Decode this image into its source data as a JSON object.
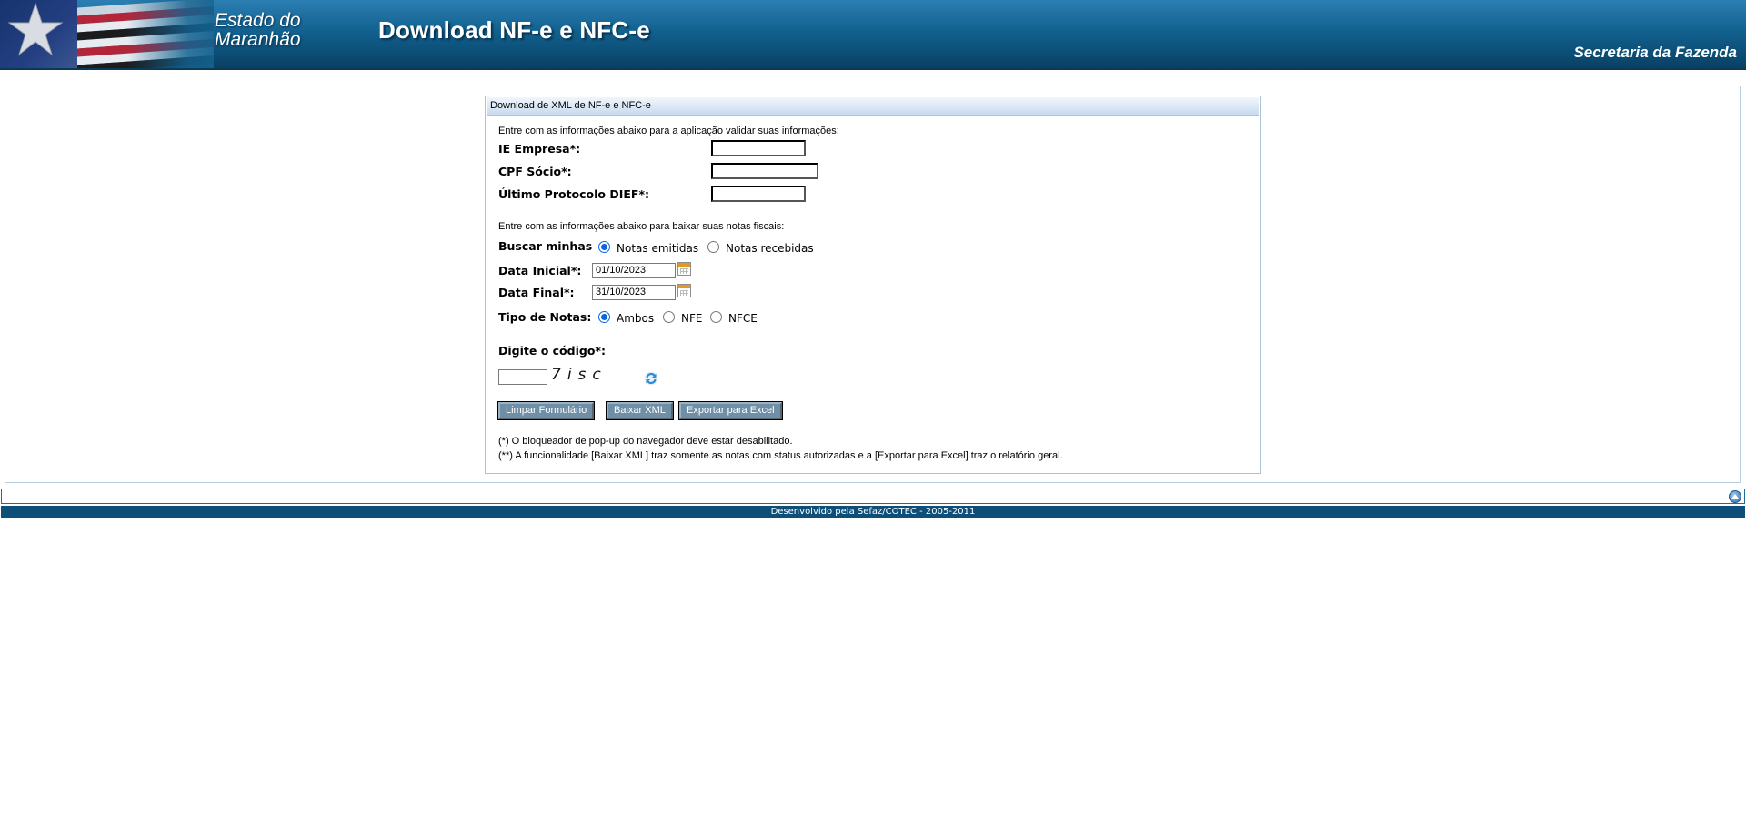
{
  "header": {
    "estado_line1": "Estado do",
    "estado_line2": "Maranhão",
    "title": "Download NF-e e NFC-e",
    "secretaria": "Secretaria da Fazenda"
  },
  "panel": {
    "title": "Download de XML de NF-e e NFC-e",
    "section1_intro": "Entre com as informações abaixo para a aplicação validar suas informações:",
    "ie_label": "IE Empresa*:",
    "cpf_label": "CPF Sócio*:",
    "protocolo_label": "Último Protocolo DIEF*:",
    "ie_value": "",
    "cpf_value": "",
    "protocolo_value": "",
    "section2_intro": "Entre com as informações abaixo para baixar suas notas fiscais:",
    "buscar_label": "Buscar minhas",
    "buscar_options": [
      "Notas emitidas",
      "Notas recebidas"
    ],
    "buscar_selected": "Notas emitidas",
    "data_inicial_label": "Data Inicial*:",
    "data_inicial_value": "01/10/2023",
    "data_final_label": "Data Final*:",
    "data_final_value": "31/10/2023",
    "tipo_label": "Tipo de Notas:",
    "tipo_options": [
      "Ambos",
      "NFE",
      "NFCE"
    ],
    "tipo_selected": "Ambos",
    "captcha_label": "Digite o código*:",
    "captcha_text": "7isc",
    "captcha_input_value": "",
    "buttons": {
      "limpar": "Limpar Formulário",
      "baixar": "Baixar XML",
      "exportar": "Exportar para Excel"
    },
    "note1": "(*) O bloqueador de pop-up do navegador deve estar desabilitado.",
    "note2": "(**) A funcionalidade [Baixar XML] traz somente as notas com status autorizadas e a [Exportar para Excel] traz o relatório geral."
  },
  "footer": {
    "credit": "Desenvolvido pela Sefaz/COTEC - 2005-2011"
  },
  "icons": {
    "calendar": "calendar-icon",
    "refresh": "refresh-icon",
    "back_to_top": "arrow-up-icon",
    "logo_star": "star-icon"
  },
  "colors": {
    "header_blue": "#12618f",
    "footer_blue": "#0d4f78",
    "button_bg": "#6f8fa6",
    "calendar_accent": "#e39a1c"
  }
}
